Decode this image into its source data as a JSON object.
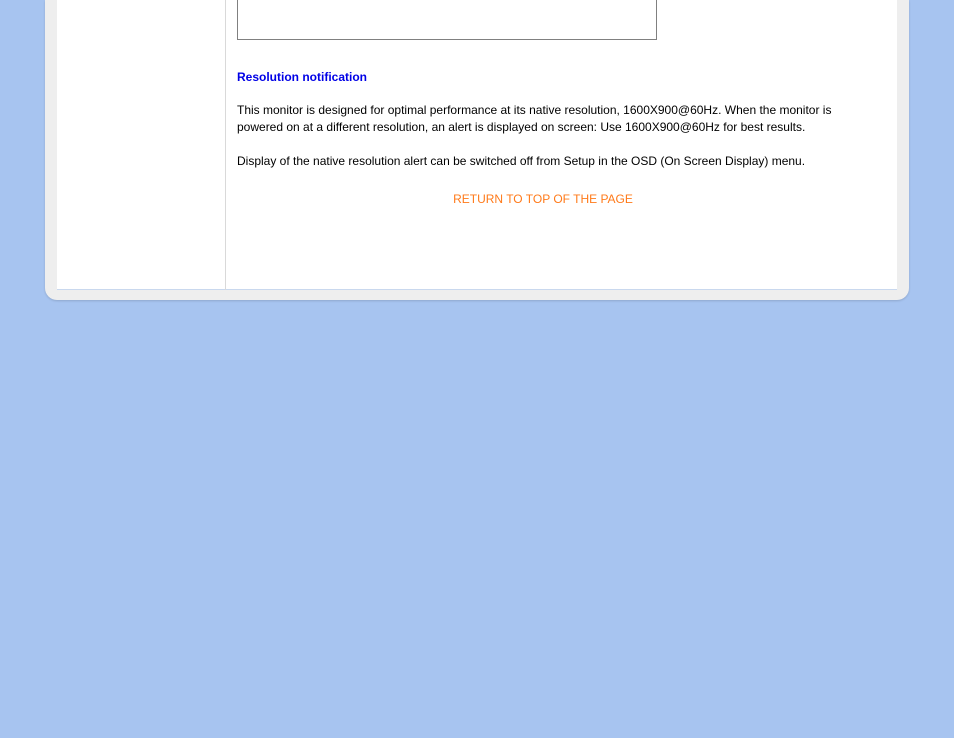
{
  "section": {
    "heading": "Resolution notification",
    "paragraph1": "This monitor is designed for optimal performance at its native resolution, 1600X900@60Hz. When the monitor is powered on at a different resolution, an alert is displayed on screen: Use 1600X900@60Hz for best results.",
    "paragraph2": "Display of the native resolution alert can be switched off from Setup in the OSD (On Screen Display) menu."
  },
  "link": {
    "return_top": "RETURN TO TOP OF THE PAGE"
  }
}
